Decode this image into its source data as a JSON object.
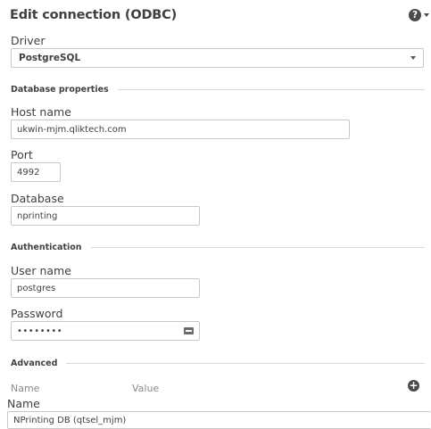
{
  "dialog": {
    "title": "Edit connection (ODBC)",
    "help_icon": "question-circle-icon"
  },
  "driver": {
    "label": "Driver",
    "selected": "PostgreSQL"
  },
  "database_properties": {
    "heading": "Database properties",
    "host_label": "Host name",
    "host_value": "ukwin-mjm.qliktech.com",
    "port_label": "Port",
    "port_value": "4992",
    "database_label": "Database",
    "database_value": "nprinting"
  },
  "authentication": {
    "heading": "Authentication",
    "username_label": "User name",
    "username_value": "postgres",
    "password_label": "Password",
    "password_masked": "••••••••",
    "password_icon": "key-icon"
  },
  "advanced": {
    "heading": "Advanced",
    "col_name": "Name",
    "col_value": "Value",
    "add_icon": "plus-circle-icon"
  },
  "connection_name": {
    "label": "Name",
    "value": "NPrinting DB (qtsel_mjm)"
  },
  "colors": {
    "text": "#404040",
    "border": "#c8c8c8",
    "divider": "#d9d9d9"
  }
}
